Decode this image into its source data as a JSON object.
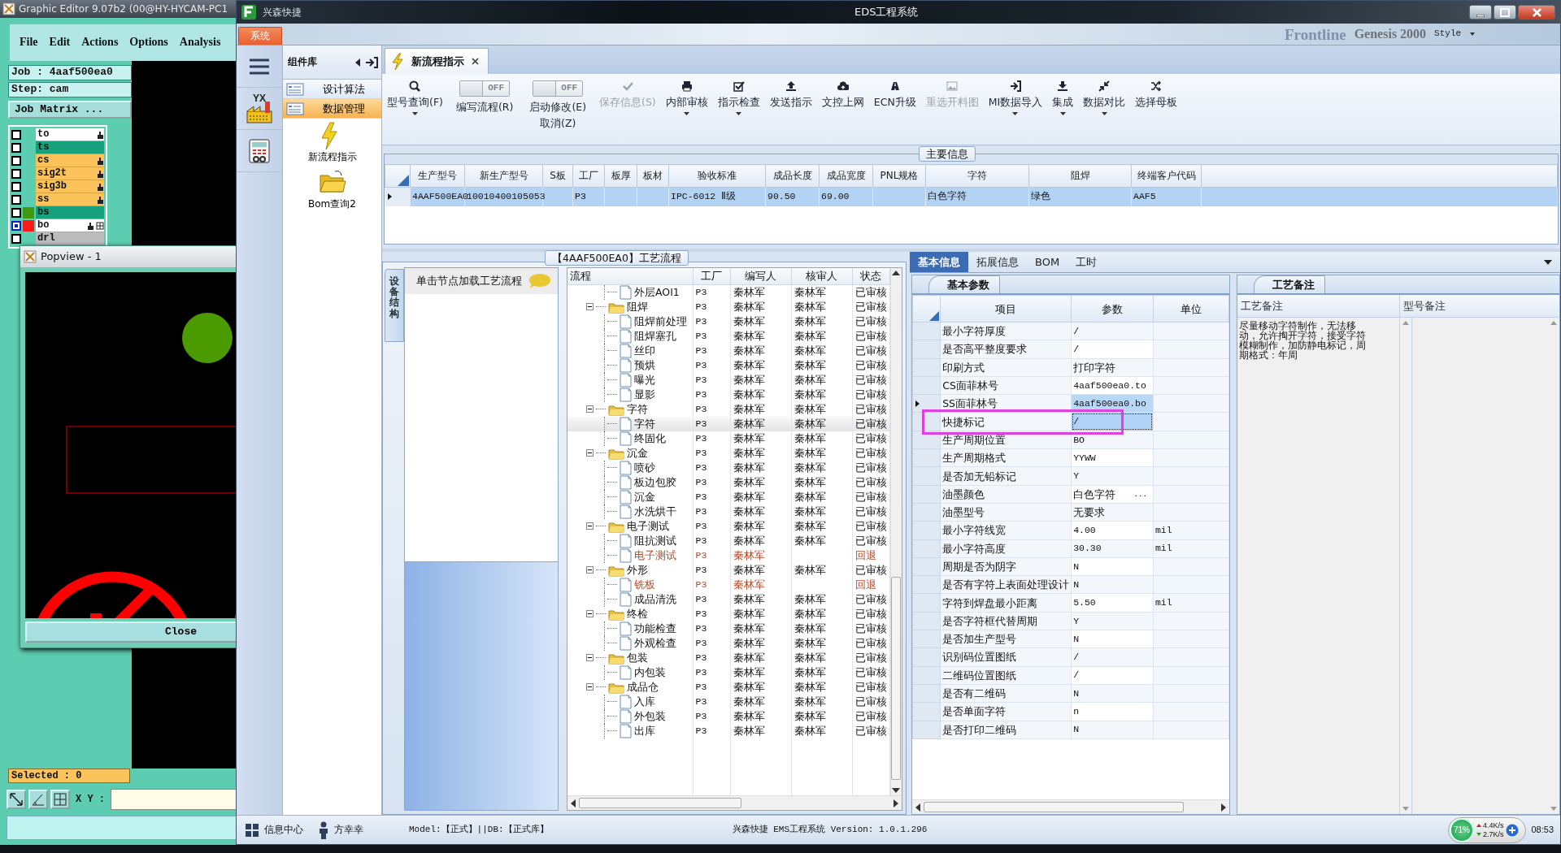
{
  "graphic_editor": {
    "title": "Graphic Editor 9.07b2 (00@HY-HYCAM-PC1",
    "menu": [
      "File",
      "Edit",
      "Actions",
      "Options",
      "Analysis"
    ],
    "job": "Job : 4aaf500ea0",
    "step": "Step: cam",
    "job_matrix_button": "Job Matrix ...",
    "layers": [
      {
        "name": "to",
        "color": "#ffffff",
        "hand": true,
        "grid": false,
        "selected": false
      },
      {
        "name": "ts",
        "color": "#16a07c",
        "hand": false,
        "grid": false,
        "selected": false
      },
      {
        "name": "cs",
        "color": "#fcc35a",
        "hand": true,
        "grid": false,
        "selected": false
      },
      {
        "name": "sig2t",
        "color": "#fcc35a",
        "hand": true,
        "grid": false,
        "selected": false
      },
      {
        "name": "sig3b",
        "color": "#fcc35a",
        "hand": true,
        "grid": false,
        "selected": false
      },
      {
        "name": "ss",
        "color": "#fcc35a",
        "hand": true,
        "grid": false,
        "selected": false
      },
      {
        "name": "bs",
        "color": "#16a07c",
        "swatch": {
          "color": "#3f9a10"
        },
        "hand": false,
        "grid": false,
        "selected": false
      },
      {
        "name": "bo",
        "color": "#ffffff",
        "swatch": {
          "color": "#ff1a1a"
        },
        "hand": true,
        "grid": true,
        "selected": true
      },
      {
        "name": "drl",
        "color": "#bcbcbc",
        "hand": false,
        "grid": false,
        "selected": false
      }
    ],
    "selected_label": "Selected : 0",
    "xy_label": "X Y :"
  },
  "popview": {
    "title": "Popview - 1",
    "close_button": "Close"
  },
  "background_app": {
    "brand": "Frontline",
    "product": "Genesis 2000",
    "style_menu": "Style"
  },
  "window": {
    "app_name": "兴森快捷",
    "title": "EDS工程系统"
  },
  "menu_tab": "系统",
  "component_panel": {
    "title": "组件库",
    "categories": [
      {
        "label": "设计算法",
        "selected": false
      },
      {
        "label": "数据管理",
        "selected": true
      }
    ],
    "items": [
      {
        "label": "新流程指示",
        "kind": "lightning"
      },
      {
        "label": "Bom查询2",
        "kind": "folder"
      }
    ]
  },
  "rail_logo": "YX",
  "doc_tab": {
    "label": "新流程指示"
  },
  "toolbar": [
    {
      "kind": "button",
      "label": "型号查询(F)",
      "dropdown": true,
      "disabled": false
    },
    {
      "kind": "toggle",
      "switch_text": "OFF",
      "on": false,
      "label": "编写流程(R)"
    },
    {
      "kind": "toggle",
      "switch_text": "OFF",
      "on": false,
      "label": "启动修改(E)",
      "sublabel": "取消(Z)"
    },
    {
      "kind": "button",
      "label": "保存信息(S)",
      "dropdown": false,
      "disabled": true
    },
    {
      "kind": "button",
      "label": "内部审核",
      "dropdown": true,
      "disabled": false
    },
    {
      "kind": "button",
      "label": "指示检查",
      "dropdown": true,
      "disabled": false
    },
    {
      "kind": "button",
      "label": "发送指示",
      "dropdown": false,
      "disabled": false
    },
    {
      "kind": "button",
      "label": "文控上网",
      "dropdown": false,
      "disabled": false
    },
    {
      "kind": "button",
      "label": "ECN升级",
      "dropdown": false,
      "disabled": false
    },
    {
      "kind": "button",
      "label": "重选开料图",
      "dropdown": false,
      "disabled": true
    },
    {
      "kind": "button",
      "label": "MI数据导入",
      "dropdown": true,
      "disabled": false
    },
    {
      "kind": "button",
      "label": "集成",
      "dropdown": true,
      "disabled": false
    },
    {
      "kind": "button",
      "label": "数据对比",
      "dropdown": true,
      "disabled": false
    },
    {
      "kind": "button",
      "label": "选择母板",
      "dropdown": false,
      "disabled": false
    }
  ],
  "main_info": {
    "title": "主要信息",
    "row_selected": true,
    "columns": [
      {
        "label": "生产型号",
        "value": "4AAF500EA0"
      },
      {
        "label": "新生产型号",
        "value": "10010400105053"
      },
      {
        "label": "S板"
      },
      {
        "label": "工厂",
        "value": "P3"
      },
      {
        "label": "板厚"
      },
      {
        "label": "板材"
      },
      {
        "label": "验收标准",
        "value": "IPC-6012 Ⅱ级"
      },
      {
        "label": "成品长度",
        "value": "90.50"
      },
      {
        "label": "成品宽度",
        "value": "69.00"
      },
      {
        "label": "PNL规格"
      },
      {
        "label": "字符",
        "value": "白色字符"
      },
      {
        "label": "阻焊",
        "value": "绿色"
      },
      {
        "label": "终端客户代码",
        "value": "AAF5"
      }
    ]
  },
  "process": {
    "title": "【4AAF500EA0】工艺流程",
    "side_tab": "设备结构",
    "hint": "单击节点加载工艺流程",
    "columns": [
      "流程",
      "工厂",
      "编写人",
      "核审人",
      "状态"
    ],
    "tree": [
      {
        "kind": "step",
        "name": "外层AOI1",
        "factory": "P3",
        "writer": "秦林军",
        "reviewer": "秦林军",
        "status": "已审核",
        "rejected": false,
        "selected": false
      },
      {
        "kind": "group",
        "name": "阻焊",
        "factory": "P3",
        "writer": "秦林军",
        "reviewer": "秦林军",
        "status": "已审核",
        "rejected": false,
        "selected": false,
        "expanded": true,
        "children": [
          {
            "kind": "step",
            "name": "阻焊前处理",
            "factory": "P3",
            "writer": "秦林军",
            "reviewer": "秦林军",
            "status": "已审核",
            "rejected": false,
            "selected": false
          },
          {
            "kind": "step",
            "name": "阻焊塞孔",
            "factory": "P3",
            "writer": "秦林军",
            "reviewer": "秦林军",
            "status": "已审核",
            "rejected": false,
            "selected": false
          },
          {
            "kind": "step",
            "name": "丝印",
            "factory": "P3",
            "writer": "秦林军",
            "reviewer": "秦林军",
            "status": "已审核",
            "rejected": false,
            "selected": false
          },
          {
            "kind": "step",
            "name": "预烘",
            "factory": "P3",
            "writer": "秦林军",
            "reviewer": "秦林军",
            "status": "已审核",
            "rejected": false,
            "selected": false
          },
          {
            "kind": "step",
            "name": "曝光",
            "factory": "P3",
            "writer": "秦林军",
            "reviewer": "秦林军",
            "status": "已审核",
            "rejected": false,
            "selected": false
          },
          {
            "kind": "step",
            "name": "显影",
            "factory": "P3",
            "writer": "秦林军",
            "reviewer": "秦林军",
            "status": "已审核",
            "rejected": false,
            "selected": false
          }
        ]
      },
      {
        "kind": "group",
        "name": "字符",
        "factory": "P3",
        "writer": "秦林军",
        "reviewer": "秦林军",
        "status": "已审核",
        "rejected": false,
        "selected": false,
        "expanded": true,
        "children": [
          {
            "kind": "step",
            "name": "字符",
            "factory": "P3",
            "writer": "秦林军",
            "reviewer": "秦林军",
            "status": "已审核",
            "rejected": false,
            "selected": true
          },
          {
            "kind": "step",
            "name": "终固化",
            "factory": "P3",
            "writer": "秦林军",
            "reviewer": "秦林军",
            "status": "已审核",
            "rejected": false,
            "selected": false
          }
        ]
      },
      {
        "kind": "group",
        "name": "沉金",
        "factory": "P3",
        "writer": "秦林军",
        "reviewer": "秦林军",
        "status": "已审核",
        "rejected": false,
        "selected": false,
        "expanded": true,
        "children": [
          {
            "kind": "step",
            "name": "喷砂",
            "factory": "P3",
            "writer": "秦林军",
            "reviewer": "秦林军",
            "status": "已审核",
            "rejected": false,
            "selected": false
          },
          {
            "kind": "step",
            "name": "板边包胶",
            "factory": "P3",
            "writer": "秦林军",
            "reviewer": "秦林军",
            "status": "已审核",
            "rejected": false,
            "selected": false
          },
          {
            "kind": "step",
            "name": "沉金",
            "factory": "P3",
            "writer": "秦林军",
            "reviewer": "秦林军",
            "status": "已审核",
            "rejected": false,
            "selected": false
          },
          {
            "kind": "step",
            "name": "水洗烘干",
            "factory": "P3",
            "writer": "秦林军",
            "reviewer": "秦林军",
            "status": "已审核",
            "rejected": false,
            "selected": false
          }
        ]
      },
      {
        "kind": "group",
        "name": "电子测试",
        "factory": "P3",
        "writer": "秦林军",
        "reviewer": "秦林军",
        "status": "已审核",
        "rejected": false,
        "selected": false,
        "expanded": true,
        "children": [
          {
            "kind": "step",
            "name": "阻抗测试",
            "factory": "P3",
            "writer": "秦林军",
            "reviewer": "秦林军",
            "status": "已审核",
            "rejected": false,
            "selected": false
          },
          {
            "kind": "step",
            "name": "电子测试",
            "factory": "P3",
            "writer": "秦林军",
            "status": "回退",
            "rejected": true,
            "selected": false
          }
        ]
      },
      {
        "kind": "group",
        "name": "外形",
        "factory": "P3",
        "writer": "秦林军",
        "reviewer": "秦林军",
        "status": "已审核",
        "rejected": false,
        "selected": false,
        "expanded": true,
        "children": [
          {
            "kind": "step",
            "name": "铣板",
            "factory": "P3",
            "writer": "秦林军",
            "status": "回退",
            "rejected": true,
            "selected": false
          },
          {
            "kind": "step",
            "name": "成品清洗",
            "factory": "P3",
            "writer": "秦林军",
            "reviewer": "秦林军",
            "status": "已审核",
            "rejected": false,
            "selected": false
          }
        ]
      },
      {
        "kind": "group",
        "name": "终检",
        "factory": "P3",
        "writer": "秦林军",
        "reviewer": "秦林军",
        "status": "已审核",
        "rejected": false,
        "selected": false,
        "expanded": true,
        "children": [
          {
            "kind": "step",
            "name": "功能检查",
            "factory": "P3",
            "writer": "秦林军",
            "reviewer": "秦林军",
            "status": "已审核",
            "rejected": false,
            "selected": false
          },
          {
            "kind": "step",
            "name": "外观检查",
            "factory": "P3",
            "writer": "秦林军",
            "reviewer": "秦林军",
            "status": "已审核",
            "rejected": false,
            "selected": false
          }
        ]
      },
      {
        "kind": "group",
        "name": "包装",
        "factory": "P3",
        "writer": "秦林军",
        "reviewer": "秦林军",
        "status": "已审核",
        "rejected": false,
        "selected": false,
        "expanded": true,
        "children": [
          {
            "kind": "step",
            "name": "内包装",
            "factory": "P3",
            "writer": "秦林军",
            "reviewer": "秦林军",
            "status": "已审核",
            "rejected": false,
            "selected": false
          }
        ]
      },
      {
        "kind": "group",
        "name": "成品仓",
        "factory": "P3",
        "writer": "秦林军",
        "reviewer": "秦林军",
        "status": "已审核",
        "rejected": false,
        "selected": false,
        "expanded": true,
        "children": [
          {
            "kind": "step",
            "name": "入库",
            "factory": "P3",
            "writer": "秦林军",
            "reviewer": "秦林军",
            "status": "已审核",
            "rejected": false,
            "selected": false
          },
          {
            "kind": "step",
            "name": "外包装",
            "factory": "P3",
            "writer": "秦林军",
            "reviewer": "秦林军",
            "status": "已审核",
            "rejected": false,
            "selected": false
          },
          {
            "kind": "step",
            "name": "出库",
            "factory": "P3",
            "writer": "秦林军",
            "reviewer": "秦林军",
            "status": "已审核",
            "rejected": false,
            "selected": false
          }
        ]
      }
    ]
  },
  "detail_tabs": [
    {
      "label": "基本信息",
      "selected": true
    },
    {
      "label": "拓展信息",
      "selected": false
    },
    {
      "label": "BOM",
      "selected": false
    },
    {
      "label": "工时",
      "selected": false
    }
  ],
  "params": {
    "title": "基本参数",
    "columns": [
      "项目",
      "参数",
      "单位"
    ],
    "rows": [
      {
        "item": "最小字符厚度",
        "value": "/",
        "selected": false,
        "focused": false,
        "marked": false
      },
      {
        "item": "是否高平整度要求",
        "value": "/",
        "selected": false,
        "focused": false,
        "marked": false
      },
      {
        "item": "印刷方式",
        "value": "打印字符",
        "selected": false,
        "focused": false,
        "marked": false
      },
      {
        "item": "CS面菲林号",
        "value": "4aaf500ea0.to",
        "selected": false,
        "focused": false,
        "marked": false
      },
      {
        "item": "SS面菲林号",
        "value": "4aaf500ea0.bo",
        "selected": true,
        "focused": false,
        "marked": false
      },
      {
        "item": "快捷标记",
        "value": "/",
        "selected": false,
        "focused": true,
        "marked": true
      },
      {
        "item": "生产周期位置",
        "value": "BO",
        "selected": false,
        "focused": false,
        "marked": false
      },
      {
        "item": "生产周期格式",
        "value": "YYWW",
        "selected": false,
        "focused": false,
        "marked": false
      },
      {
        "item": "是否加无铅标记",
        "value": "Y",
        "selected": false,
        "focused": false,
        "marked": false
      },
      {
        "item": "油墨颜色",
        "value": "白色字符",
        "button": "...",
        "selected": false,
        "focused": false,
        "marked": false
      },
      {
        "item": "油墨型号",
        "value": "无要求",
        "selected": false,
        "focused": false,
        "marked": false
      },
      {
        "item": "最小字符线宽",
        "value": "4.00",
        "unit": "mil",
        "selected": false,
        "focused": false,
        "marked": false
      },
      {
        "item": "最小字符高度",
        "value": "30.30",
        "unit": "mil",
        "selected": false,
        "focused": false,
        "marked": false
      },
      {
        "item": "周期是否为阴字",
        "value": "N",
        "selected": false,
        "focused": false,
        "marked": false
      },
      {
        "item": "是否有字符上表面处理设计",
        "value": "N",
        "selected": false,
        "focused": false,
        "marked": false
      },
      {
        "item": "字符到焊盘最小距离",
        "value": "5.50",
        "unit": "mil",
        "selected": false,
        "focused": false,
        "marked": false
      },
      {
        "item": "是否字符框代替周期",
        "value": "Y",
        "selected": false,
        "focused": false,
        "marked": false
      },
      {
        "item": "是否加生产型号",
        "value": "N",
        "selected": false,
        "focused": false,
        "marked": false
      },
      {
        "item": "识别码位置图纸",
        "value": "/",
        "selected": false,
        "focused": false,
        "marked": false
      },
      {
        "item": "二维码位置图纸",
        "value": "/",
        "selected": false,
        "focused": false,
        "marked": false
      },
      {
        "item": "是否有二维码",
        "value": "N",
        "selected": false,
        "focused": false,
        "marked": false
      },
      {
        "item": "是否单面字符",
        "value": "n",
        "selected": false,
        "focused": false,
        "marked": false
      },
      {
        "item": "是否打印二维码",
        "value": "N",
        "selected": false,
        "focused": false,
        "marked": false
      }
    ]
  },
  "notes": {
    "title": "工艺备注",
    "columns": [
      "工艺备注",
      "型号备注"
    ],
    "text": "尽量移动字符制作，无法移动，允许掏开字符，接受字符模糊制作，加防静电标记，周期格式：年周"
  },
  "status_bar": {
    "info_center": "信息中心",
    "user": "方幸幸",
    "model": "Model:【正式】||DB:【正式库】",
    "version": "兴森快捷 EMS工程系统 Version: 1.0.1.296",
    "cpu": "71%",
    "upload": "4.4K/s",
    "download": "2.7K/s",
    "time": "08:53"
  }
}
